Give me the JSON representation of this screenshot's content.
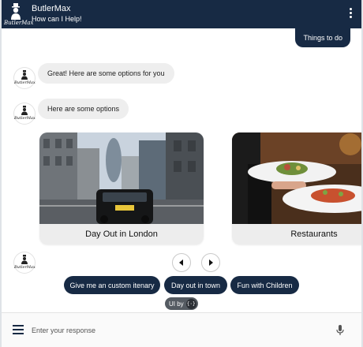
{
  "header": {
    "title": "ButlerMax",
    "subtitle": "How can I Help!",
    "logo_text": "ButlerMax",
    "bg_color": "#172a44"
  },
  "chat": {
    "user_message": "Things to do",
    "bot_messages": [
      "Great! Here are some options for you",
      "Here are some options"
    ],
    "avatar_text": "ButlerMax"
  },
  "carousel": {
    "cards": [
      {
        "label": "Day Out in London",
        "image": "london-street-photo"
      },
      {
        "label": "Restaurants",
        "image": "restaurant-dishes-photo"
      }
    ],
    "prev_icon": "chevron-left-icon",
    "next_icon": "chevron-right-icon"
  },
  "quick_replies": [
    "Give me an custom itenary",
    "Day out in town",
    "Fun with Children"
  ],
  "branding": {
    "label": "UI by",
    "badge": "{·}"
  },
  "input": {
    "placeholder": "Enter your response"
  }
}
